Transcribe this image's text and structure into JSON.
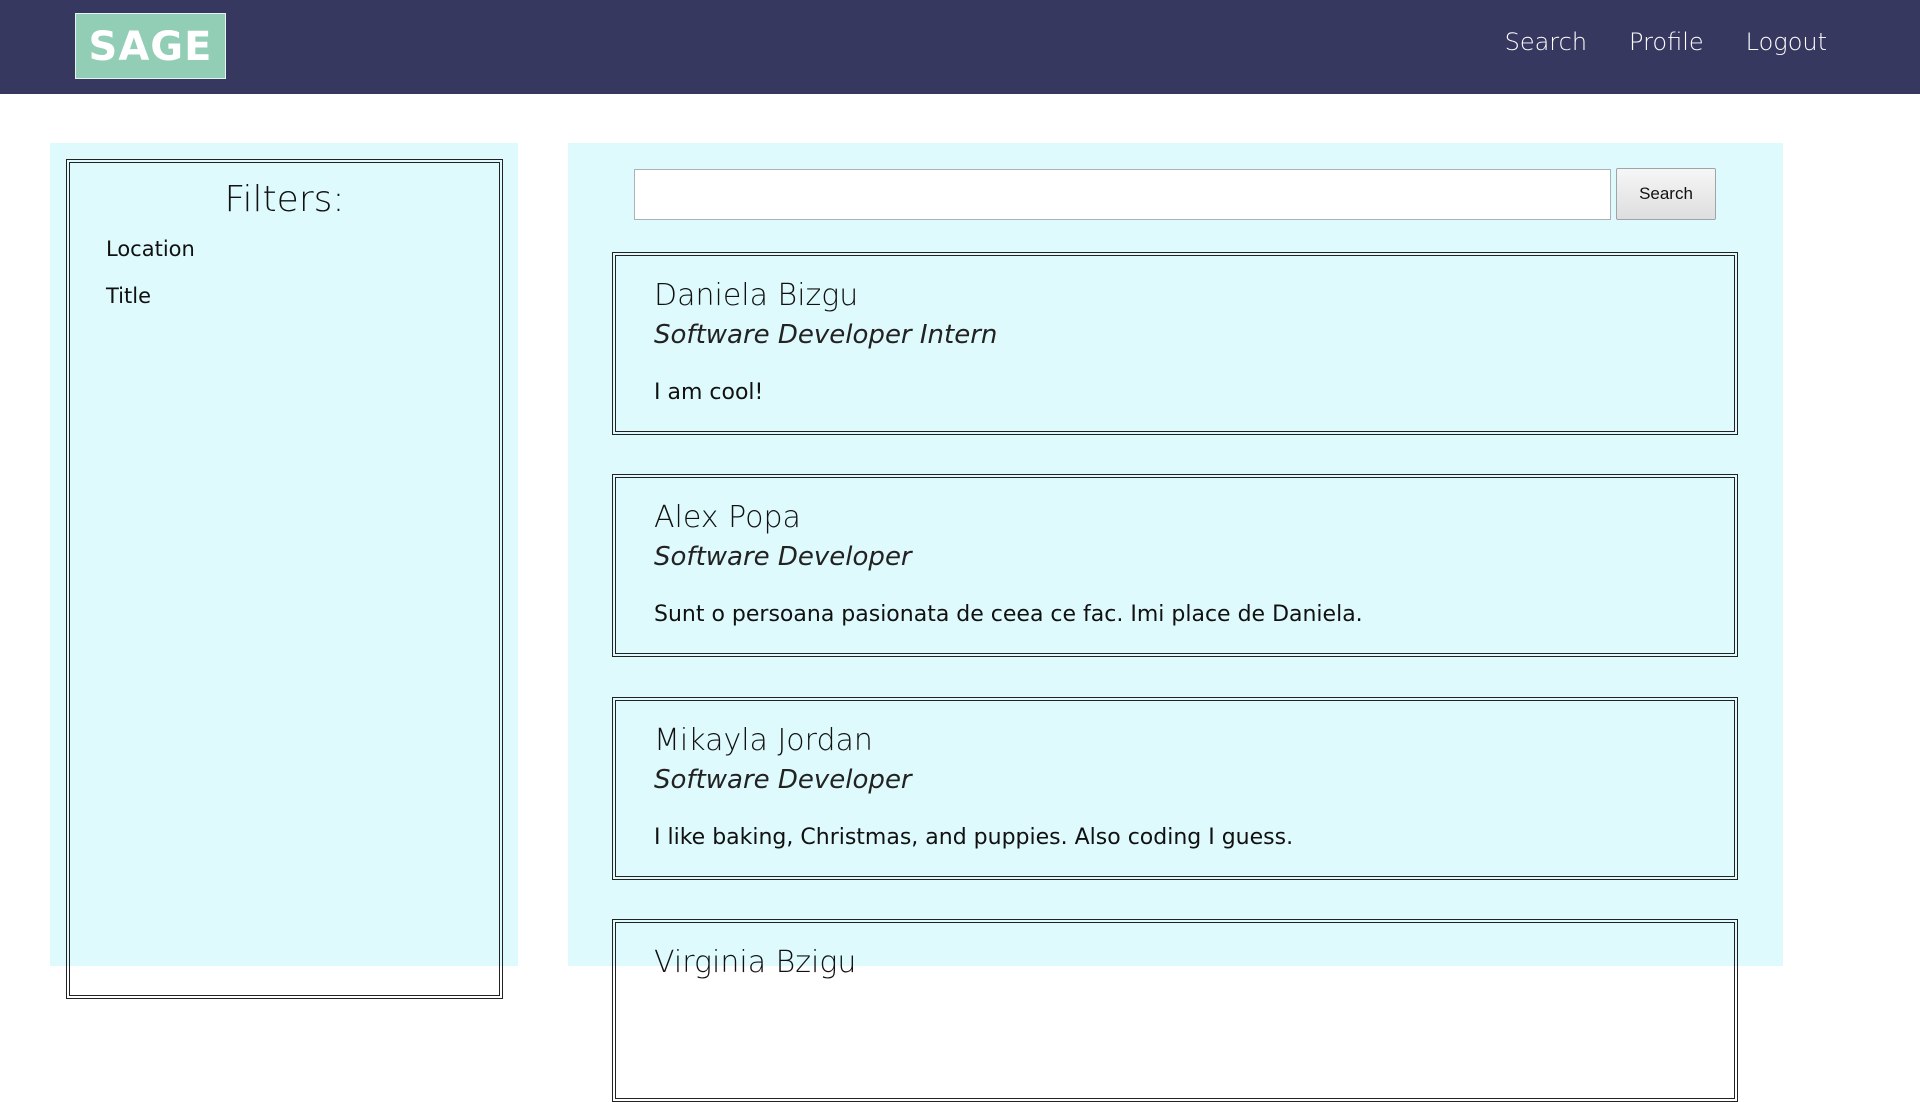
{
  "header": {
    "logo_text": "SAGE",
    "nav": {
      "search_label": "Search",
      "profile_label": "Profile",
      "logout_label": "Logout"
    }
  },
  "filters": {
    "title": "Filters:",
    "items": [
      "Location",
      "Title"
    ]
  },
  "search": {
    "value": "",
    "placeholder": "",
    "button_label": "Search"
  },
  "profiles": [
    {
      "name": "Daniela Bizgu",
      "title": "Software Developer Intern",
      "bio": "I am cool!"
    },
    {
      "name": "Alex Popa",
      "title": "Software Developer",
      "bio": "Sunt o persoana pasionata de ceea ce fac. Imi place de Daniela."
    },
    {
      "name": "Mikayla Jordan",
      "title": "Software Developer",
      "bio": "I like baking, Christmas, and puppies. Also coding I guess."
    },
    {
      "name": "Virginia Bzigu",
      "title": "",
      "bio": ""
    }
  ],
  "colors": {
    "header_bg": "#363860",
    "logo_bg": "#92cdb5",
    "panel_bg": "#defafc"
  }
}
